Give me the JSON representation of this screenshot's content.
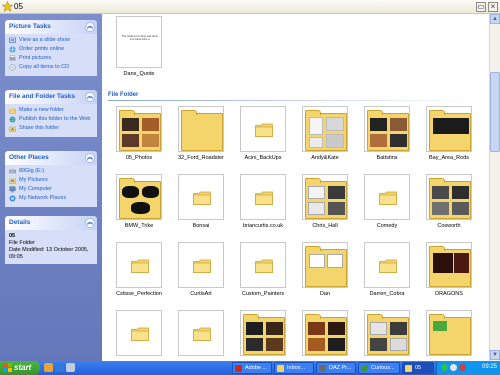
{
  "window": {
    "title": "05"
  },
  "tasks": {
    "picture": {
      "header": "Picture Tasks",
      "items": [
        "View as a slide show",
        "Order prints online",
        "Print pictures",
        "Copy all items to CD"
      ]
    },
    "file_folder": {
      "header": "File and Folder Tasks",
      "items": [
        "Make a new folder",
        "Publish this folder to the Web",
        "Share this folder"
      ]
    },
    "other_places": {
      "header": "Other Places",
      "items": [
        "80Gig (E:)",
        "My Pictures",
        "My Computer",
        "My Network Places"
      ]
    },
    "details": {
      "header": "Details",
      "name": "05",
      "type": "File Folder",
      "modified": "Date Modified: 13 October 2005, 09:05"
    }
  },
  "main": {
    "top_item": {
      "label": "Dans_Quote",
      "caption_text": "The reward of a thing well done, is to have done it."
    },
    "group_label": "File Folder",
    "folders_row1": [
      "05_Photos",
      "32_Ford_Roadster",
      "Acini_BackUps",
      "Andy&Kate",
      "Battstins",
      "Bay_Area_Rods"
    ],
    "folders_row2": [
      "BMW_Trike",
      "Bonsai",
      "briancurtis.co.uk",
      "Chris_Hall",
      "Comedy",
      "Cosworth"
    ],
    "folders_row3": [
      "Cstisse_Perfection",
      "CurtisArt",
      "Custom_Painters",
      "Dan",
      "Darren_Cobra",
      "DRAGONS"
    ]
  },
  "taskbar": {
    "start": "start",
    "tasks": [
      "Adobe ...",
      "Inbox...",
      "DAZ Pr...",
      "Curious...",
      "05"
    ],
    "clock": "09:25"
  },
  "colors": {
    "accent": "#215dc6",
    "folder": "#f3d56b",
    "taskbar": "#245edb"
  }
}
